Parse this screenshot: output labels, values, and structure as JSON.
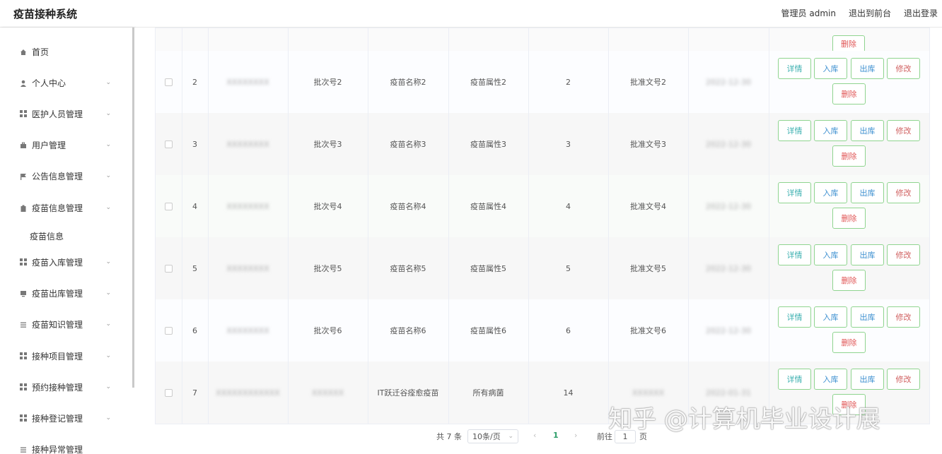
{
  "header": {
    "brand": "疫苗接种系统",
    "user": "管理员 admin",
    "to_front": "退出到前台",
    "logout": "退出登录"
  },
  "sidebar": {
    "items": [
      {
        "label": "首页",
        "icon": "home-icon"
      },
      {
        "label": "个人中心",
        "icon": "user-icon"
      },
      {
        "label": "医护人员管理",
        "icon": "grid-icon"
      },
      {
        "label": "用户管理",
        "icon": "briefcase-icon"
      },
      {
        "label": "公告信息管理",
        "icon": "flag-icon"
      },
      {
        "label": "疫苗信息管理",
        "icon": "clipboard-icon"
      },
      {
        "label": "疫苗入库管理",
        "icon": "grid-icon"
      },
      {
        "label": "疫苗出库管理",
        "icon": "monitor-icon"
      },
      {
        "label": "疫苗知识管理",
        "icon": "list-icon"
      },
      {
        "label": "接种项目管理",
        "icon": "grid-icon"
      },
      {
        "label": "预约接种管理",
        "icon": "grid-icon"
      },
      {
        "label": "接种登记管理",
        "icon": "grid-icon"
      },
      {
        "label": "接种异常管理",
        "icon": "list-icon"
      }
    ],
    "sub_item": "疫苗信息"
  },
  "table": {
    "rows": [
      {
        "index": "2",
        "code": "XXXXXXXX",
        "batch": "批次号2",
        "name": "疫苗名称2",
        "attr": "疫苗属性2",
        "qty": "2",
        "approval": "批准文号2",
        "date": "2022-12-30"
      },
      {
        "index": "3",
        "code": "XXXXXXXX",
        "batch": "批次号3",
        "name": "疫苗名称3",
        "attr": "疫苗属性3",
        "qty": "3",
        "approval": "批准文号3",
        "date": "2022-12-30"
      },
      {
        "index": "4",
        "code": "XXXXXXXX",
        "batch": "批次号4",
        "name": "疫苗名称4",
        "attr": "疫苗属性4",
        "qty": "4",
        "approval": "批准文号4",
        "date": "2022-12-30"
      },
      {
        "index": "5",
        "code": "XXXXXXXX",
        "batch": "批次号5",
        "name": "疫苗名称5",
        "attr": "疫苗属性5",
        "qty": "5",
        "approval": "批准文号5",
        "date": "2022-12-30"
      },
      {
        "index": "6",
        "code": "XXXXXXXX",
        "batch": "批次号6",
        "name": "疫苗名称6",
        "attr": "疫苗属性6",
        "qty": "6",
        "approval": "批准文号6",
        "date": "2022-12-30"
      },
      {
        "index": "7",
        "code": "XXXXXXXXXXXX",
        "batch": "XXXXXX",
        "name": "IT跃迁谷痊愈疫苗",
        "attr": "所有病菌",
        "qty": "14",
        "approval": "XXXXXX",
        "date": "2022-01-31"
      }
    ],
    "actions": {
      "detail": "详情",
      "in": "入库",
      "out": "出库",
      "edit": "修改",
      "delete": "删除"
    }
  },
  "pagination": {
    "total": "共 7 条",
    "page_size": "10条/页",
    "current": "1",
    "goto_label": "前往",
    "goto_value": "1",
    "page_suffix": "页"
  },
  "watermark": "知乎 @计算机毕业设计展"
}
